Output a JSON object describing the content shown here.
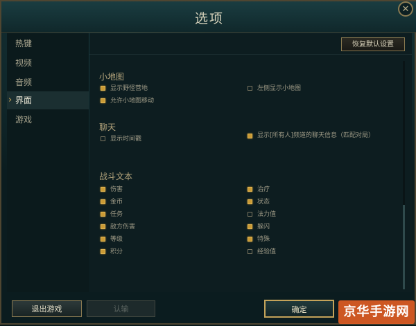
{
  "window": {
    "title": "选项",
    "close_icon": "close-icon"
  },
  "sidebar": {
    "items": [
      {
        "label": "热键",
        "active": false
      },
      {
        "label": "视频",
        "active": false
      },
      {
        "label": "音频",
        "active": false
      },
      {
        "label": "界面",
        "active": true
      },
      {
        "label": "游戏",
        "active": false
      }
    ]
  },
  "toolbar": {
    "reset_label": "恢复默认设置"
  },
  "sections": {
    "minimap": {
      "title": "小地图",
      "options": [
        {
          "label": "显示野怪营地",
          "checked": true
        },
        {
          "label": "左侧显示小地图",
          "checked": false
        },
        {
          "label": "允许小地图移动",
          "checked": true
        }
      ]
    },
    "chat": {
      "title": "聊天",
      "options": [
        {
          "label": "显示时间戳",
          "checked": false
        },
        {
          "label": "显示[所有人]频道的聊天信息（匹配对局）",
          "checked": true
        }
      ]
    },
    "combat_text": {
      "title": "战斗文本",
      "options": [
        {
          "label": "伤害",
          "checked": true
        },
        {
          "label": "治疗",
          "checked": true
        },
        {
          "label": "金币",
          "checked": true
        },
        {
          "label": "状态",
          "checked": true
        },
        {
          "label": "任务",
          "checked": true
        },
        {
          "label": "法力值",
          "checked": false
        },
        {
          "label": "敌方伤害",
          "checked": true
        },
        {
          "label": "躲闪",
          "checked": true
        },
        {
          "label": "等级",
          "checked": true
        },
        {
          "label": "特殊",
          "checked": true
        },
        {
          "label": "积分",
          "checked": true
        },
        {
          "label": "经验值",
          "checked": false
        }
      ]
    }
  },
  "footer": {
    "exit_label": "退出游戏",
    "surrender_label": "认输",
    "ok_label": "确定"
  },
  "watermark": {
    "text": "京华手游网"
  },
  "colors": {
    "checkbox_checked": "#c99a35",
    "accent_gold": "#c4a35a",
    "panel_bg": "#0d1d20"
  }
}
